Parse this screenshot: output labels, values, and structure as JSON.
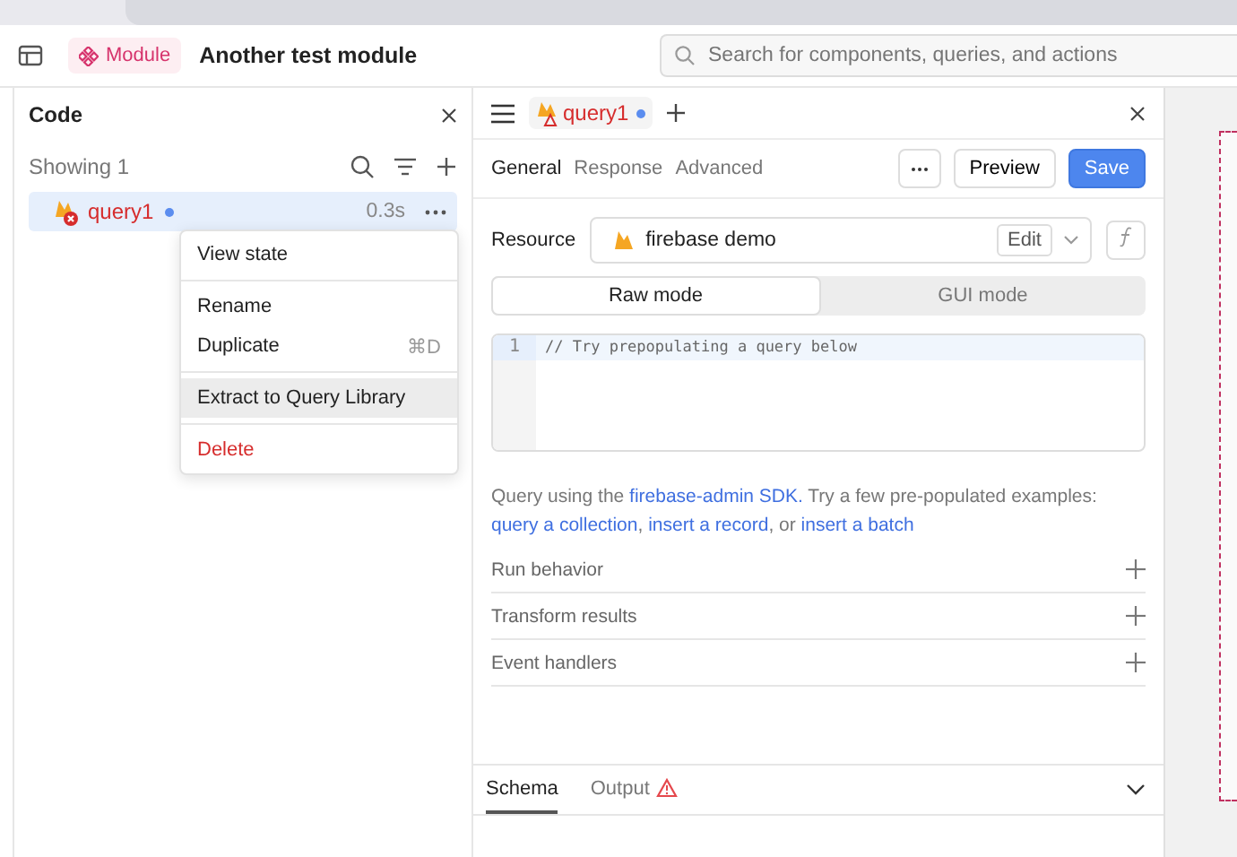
{
  "header": {
    "module_badge": "Module",
    "title": "Another test module",
    "search": {
      "placeholder": "Search for components, queries, and actions"
    }
  },
  "code_panel": {
    "title": "Code",
    "count": "Showing 1",
    "queries": [
      {
        "name": "query1",
        "time": "0.3s",
        "selected": true,
        "unsaved": true,
        "error": true
      }
    ],
    "context_menu": [
      {
        "label": "View state",
        "kind": "item",
        "selected": false
      },
      {
        "label": "Rename",
        "kind": "item",
        "selected": false
      },
      {
        "label": "Duplicate",
        "kind": "item",
        "shortcut": "⌘D",
        "selected": false
      },
      {
        "label": "Extract to Query Library",
        "kind": "item",
        "selected": true
      },
      {
        "label": "Delete",
        "kind": "danger",
        "selected": false
      }
    ]
  },
  "editor": {
    "tab": {
      "name": "query1",
      "unsaved": true
    },
    "tabs": [
      {
        "label": "General",
        "selected": true
      },
      {
        "label": "Response",
        "selected": false
      },
      {
        "label": "Advanced",
        "selected": false
      }
    ],
    "buttons": {
      "preview": "Preview",
      "save": "Save"
    },
    "resource": {
      "label": "Resource",
      "value": "firebase demo",
      "edit": "Edit"
    },
    "modes": [
      {
        "label": "Raw mode",
        "selected": true
      },
      {
        "label": "GUI mode",
        "selected": false
      }
    ],
    "code_lines": [
      {
        "number": "1",
        "text": "// Try prepopulating a query below"
      }
    ],
    "help": [
      {
        "text": "Query using the ",
        "kind": "text"
      },
      {
        "text": "firebase-admin SDK.",
        "kind": "link"
      },
      {
        "text": " Try a few pre-populated examples:",
        "kind": "text"
      },
      {
        "text": "query a collection",
        "kind": "link"
      },
      {
        "text": ", ",
        "kind": "text"
      },
      {
        "text": "insert a record",
        "kind": "link"
      },
      {
        "text": ", or ",
        "kind": "text"
      },
      {
        "text": "insert a batch",
        "kind": "link"
      }
    ],
    "sections": [
      "Run behavior",
      "Transform results",
      "Event handlers"
    ],
    "bottom_tabs": [
      {
        "label": "Schema",
        "selected": true,
        "warning": false
      },
      {
        "label": "Output",
        "selected": false,
        "warning": true
      }
    ]
  }
}
